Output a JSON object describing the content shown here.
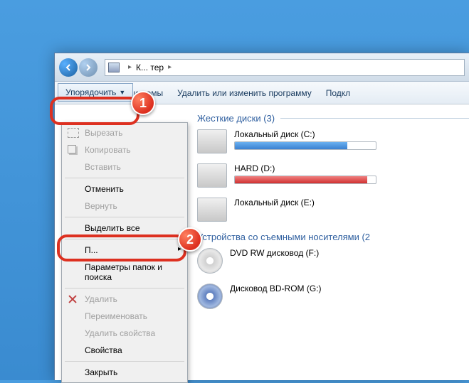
{
  "breadcrumb": {
    "location": "К...    тер"
  },
  "toolbar": {
    "organize": "Упорядочить",
    "system_props": "...йства системы",
    "uninstall": "Удалить или изменить программу",
    "connect": "Подкл"
  },
  "menu": {
    "cut": "Вырезать",
    "copy": "Копировать",
    "paste": "Вставить",
    "undo": "Отменить",
    "redo": "Вернуть",
    "select_all": "Выделить все",
    "layout": "П...",
    "folder_options": "Параметры папок и поиска",
    "delete": "Удалить",
    "rename": "Переименовать",
    "remove_props": "Удалить свойства",
    "properties": "Свойства",
    "close": "Закрыть"
  },
  "sections": {
    "hdd": "Жесткие диски (3)",
    "removable": "Устройства со съемными носителями (2"
  },
  "drives": {
    "c": {
      "name": "Локальный диск (C:)",
      "pct": 80
    },
    "d": {
      "name": "HARD (D:)",
      "pct": 94
    },
    "e": {
      "name": "Локальный диск (E:)"
    },
    "f": {
      "name": "DVD RW дисковод (F:)"
    },
    "g": {
      "name": "Дисковод BD-ROM (G:)"
    }
  },
  "annotations": {
    "step1": "1",
    "step2": "2"
  }
}
